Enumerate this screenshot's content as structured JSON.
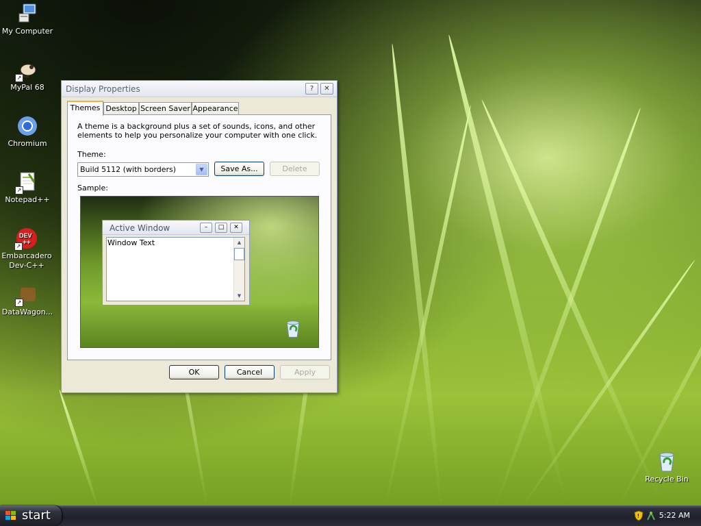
{
  "desktop": {
    "icons": [
      {
        "label": "My Computer"
      },
      {
        "label": "MyPal 68"
      },
      {
        "label": "Chromium"
      },
      {
        "label": "Notepad++"
      },
      {
        "label_line1": "Embarcadero",
        "label_line2": "Dev-C++"
      },
      {
        "label": "DataWagon..."
      },
      {
        "label": "Recycle Bin"
      }
    ]
  },
  "dialog": {
    "title": "Display Properties",
    "help_glyph": "?",
    "close_glyph": "✕",
    "tabs": [
      {
        "label": "Themes",
        "active": true
      },
      {
        "label": "Desktop"
      },
      {
        "label": "Screen Saver"
      },
      {
        "label": "Appearance"
      }
    ],
    "description": "A theme is a background plus a set of sounds, icons, and other elements to help you personalize your computer with one click.",
    "theme_label": "Theme:",
    "theme_value": "Build 5112 (with borders)",
    "save_as_label": "Save As...",
    "delete_label": "Delete",
    "sample_label": "Sample:",
    "sample": {
      "active_window_title": "Active Window",
      "window_text": "Window Text"
    },
    "ok_label": "OK",
    "cancel_label": "Cancel",
    "apply_label": "Apply"
  },
  "taskbar": {
    "start_label": "start",
    "clock": "5:22 AM"
  }
}
